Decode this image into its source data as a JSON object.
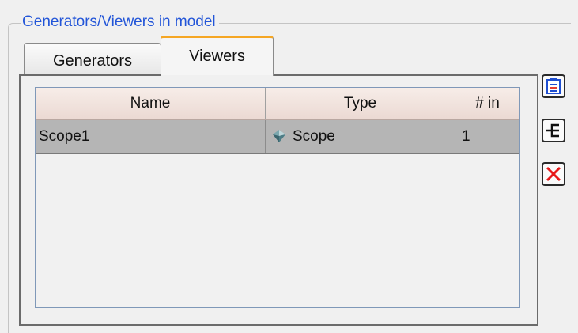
{
  "group": {
    "title": "Generators/Viewers in model"
  },
  "tabs": [
    {
      "label": "Generators",
      "active": false
    },
    {
      "label": "Viewers",
      "active": true
    }
  ],
  "table": {
    "columns": [
      "Name",
      "Type",
      "# in"
    ],
    "rows": [
      {
        "name": "Scope1",
        "type": "Scope",
        "inputs": "1",
        "type_icon": "scope-block-icon"
      }
    ]
  },
  "toolbar": {
    "buttons": [
      {
        "icon": "properties-icon"
      },
      {
        "icon": "connect-signal-icon"
      },
      {
        "icon": "delete-icon"
      }
    ]
  },
  "colors": {
    "group_title": "#2255d8",
    "active_tab_accent": "#f5a623",
    "selected_row": "#b5b5b5",
    "delete_red": "#e8191a"
  }
}
